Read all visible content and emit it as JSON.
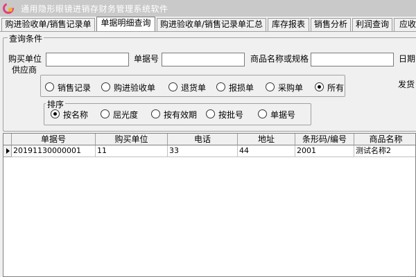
{
  "window": {
    "title": "通用隐形眼镜进销存财务管理系统软件"
  },
  "tabs": [
    {
      "label": "购进验收单/销售记录单",
      "active": false
    },
    {
      "label": "单据明细查询",
      "active": true
    },
    {
      "label": "购进验收单/销售记录单汇总",
      "active": false
    },
    {
      "label": "库存报表",
      "active": false
    },
    {
      "label": "销售分析",
      "active": false
    },
    {
      "label": "利润查询",
      "active": false
    },
    {
      "label": "应收",
      "active": false
    }
  ],
  "query": {
    "group_title": "查询条件",
    "buyer_label": "购买单位",
    "supplier_label": "供应商",
    "buyer_value": "",
    "doc_no_label": "单据号",
    "doc_no_value": "",
    "product_label": "商品名称或规格",
    "product_value": "",
    "date_label": "日期",
    "ship_label": "发货"
  },
  "doc_types": [
    {
      "label": "销售记录",
      "checked": false
    },
    {
      "label": "购进验收单",
      "checked": false
    },
    {
      "label": "退货单",
      "checked": false
    },
    {
      "label": "报损单",
      "checked": false
    },
    {
      "label": "采购单",
      "checked": false
    },
    {
      "label": "所有",
      "checked": true
    }
  ],
  "sort": {
    "title": "排序",
    "options": [
      {
        "label": "按名称",
        "checked": true
      },
      {
        "label": "屈光度",
        "checked": false
      },
      {
        "label": "按有效期",
        "checked": false
      },
      {
        "label": "按批号",
        "checked": false
      },
      {
        "label": "单据号",
        "checked": false
      }
    ]
  },
  "grid": {
    "columns": [
      "单据号",
      "购买单位",
      "电话",
      "地址",
      "条形码/编号",
      "商品名称"
    ],
    "rows": [
      [
        "20191130000001",
        "11",
        "33",
        "44",
        "2001",
        "测试名称2"
      ]
    ]
  }
}
